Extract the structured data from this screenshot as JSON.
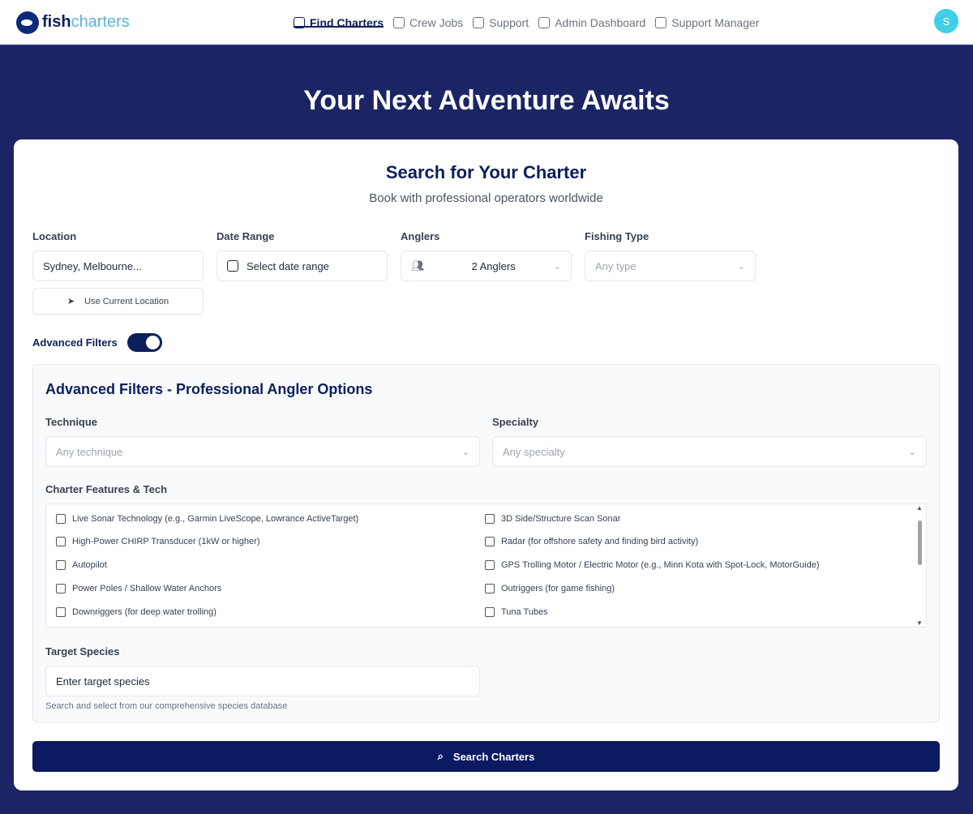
{
  "nav": {
    "brand_a": "fish",
    "brand_b": "charters",
    "items": [
      {
        "label": "Find Charters",
        "icon": "ship-icon"
      },
      {
        "label": "Crew Jobs",
        "icon": "briefcase-icon"
      },
      {
        "label": "Support",
        "icon": "headset-icon"
      },
      {
        "label": "Admin Dashboard",
        "icon": "users-icon"
      },
      {
        "label": "Support Manager",
        "icon": "headset-icon"
      }
    ],
    "avatar": "S"
  },
  "hero": {
    "title": "Your Next Adventure Awaits"
  },
  "search": {
    "title": "Search for Your Charter",
    "subtitle": "Book with professional operators worldwide",
    "location": {
      "label": "Location",
      "value": "Sydney, Melbourne..."
    },
    "use_location": "Use Current Location",
    "date": {
      "label": "Date Range",
      "placeholder": "Select date range"
    },
    "anglers": {
      "label": "Anglers",
      "value": "2 Anglers"
    },
    "fishing_type": {
      "label": "Fishing Type",
      "placeholder": "Any type"
    },
    "advanced_toggle": "Advanced Filters",
    "advanced": {
      "title": "Advanced Filters - Professional Angler Options",
      "technique": {
        "label": "Technique",
        "placeholder": "Any technique"
      },
      "specialty": {
        "label": "Specialty",
        "placeholder": "Any specialty"
      },
      "features_label": "Charter Features & Tech",
      "features": [
        "Live Sonar Technology (e.g., Garmin LiveScope, Lowrance ActiveTarget)",
        "3D Side/Structure Scan Sonar",
        "High-Power CHIRP Transducer (1kW or higher)",
        "Radar (for offshore safety and finding bird activity)",
        "Autopilot",
        "GPS Trolling Motor / Electric Motor (e.g., Minn Kota with Spot-Lock, MotorGuide)",
        "Power Poles / Shallow Water Anchors",
        "Outriggers (for game fishing)",
        "Downriggers (for deep water trolling)",
        "Tuna Tubes"
      ],
      "species": {
        "label": "Target Species",
        "placeholder": "Enter target species",
        "hint": "Search and select from our comprehensive species database"
      }
    },
    "submit": "Search Charters"
  }
}
